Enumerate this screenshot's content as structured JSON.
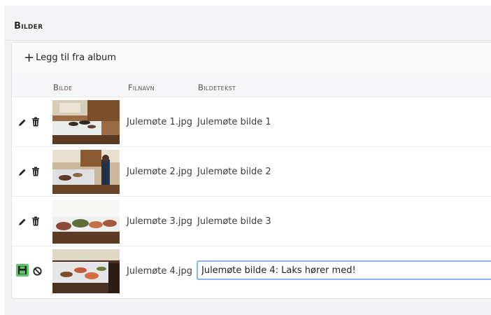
{
  "section": {
    "title": "Bilder"
  },
  "toolbar": {
    "add_label": "Legg til fra album"
  },
  "table": {
    "headers": {
      "image": "Bilde",
      "filename": "Filnavn",
      "caption": "Bildetekst"
    },
    "rows": [
      {
        "filename": "Julemøte 1.jpg",
        "caption": "Julemøte bilde 1",
        "mode": "view"
      },
      {
        "filename": "Julemøte 2.jpg",
        "caption": "Julemøte bilde 2",
        "mode": "view"
      },
      {
        "filename": "Julemøte 3.jpg",
        "caption": "Julemøte bilde 3",
        "mode": "view"
      },
      {
        "filename": "Julemøte 4.jpg",
        "caption": "Julemøte bilde 4: Laks hører med!",
        "mode": "edit"
      }
    ]
  },
  "icons": {
    "view_actions": [
      "pencil-icon",
      "trash-icon"
    ],
    "edit_actions": [
      "save-icon",
      "cancel-icon"
    ]
  },
  "colors": {
    "save_button": "#5fc36a",
    "input_focus_border": "#8db4e8"
  }
}
